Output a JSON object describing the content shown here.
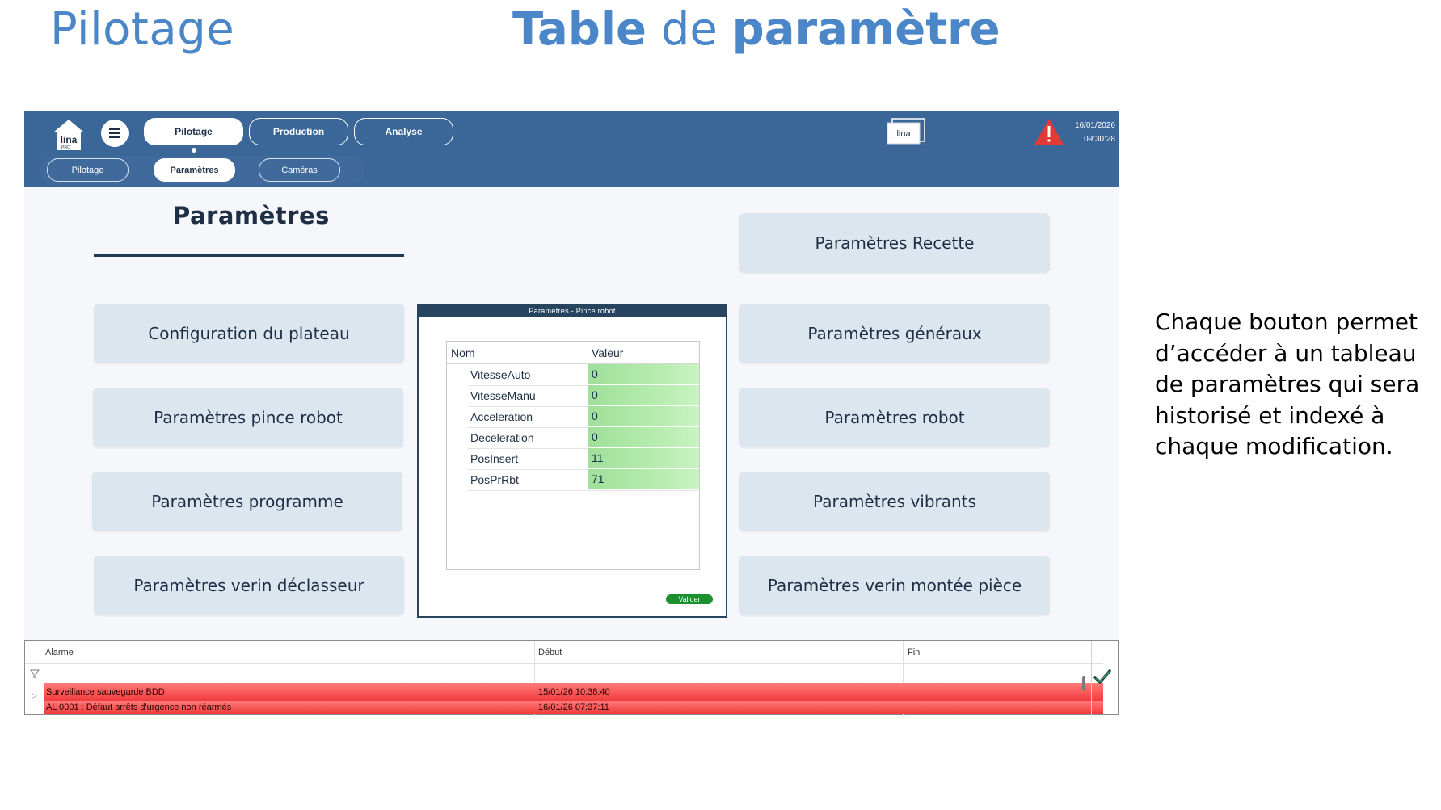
{
  "slide": {
    "title_left": "Pilotage",
    "title_center_1": "Table",
    "title_center_2": "de",
    "title_center_3": "paramètre",
    "caption": "Chaque bouton permet d’accéder à un tableau de paramètres qui sera historisé et indexé à chaque modification."
  },
  "topbar": {
    "logo_text": "lina",
    "logo_sub": "PRO",
    "tabs": [
      "Pilotage",
      "Production",
      "Analyse"
    ],
    "active_tab": "Pilotage",
    "subtabs": [
      "Pilotage",
      "Paramètres",
      "Caméras"
    ],
    "active_subtab": "Paramètres",
    "mini_logo_text": "lina",
    "date": "16/01/2026",
    "time": "09:30:28",
    "colors": {
      "bar": "#3b6698",
      "alert": "#e53935"
    }
  },
  "main": {
    "section_title": "Paramètres",
    "left_buttons": [
      "Configuration du plateau",
      "Paramètres pince robot",
      "Paramètres programme",
      "Paramètres verin déclasseur"
    ],
    "right_buttons": [
      "Paramètres Recette",
      "Paramètres généraux",
      "Paramètres robot",
      "Paramètres vibrants",
      "Paramètres verin montée pièce"
    ]
  },
  "modal": {
    "title": "Paramètres - Pince robot",
    "columns": [
      "Nom",
      "Valeur"
    ],
    "rows": [
      {
        "name": "VitesseAuto",
        "value": "0"
      },
      {
        "name": "VitesseManu",
        "value": "0"
      },
      {
        "name": "Acceleration",
        "value": "0"
      },
      {
        "name": "Deceleration",
        "value": "0"
      },
      {
        "name": "PosInsert",
        "value": "11"
      },
      {
        "name": "PosPrRbt",
        "value": "71"
      }
    ],
    "validate_label": "Valider"
  },
  "alarms": {
    "columns": [
      "Alarme",
      "Début",
      "Fin"
    ],
    "rows": [
      {
        "alarm": "Surveillance sauvegarde BDD",
        "start": "15/01/26 10:38:40",
        "end": ""
      },
      {
        "alarm": "AL 0001 : Défaut arrêts d'urgence non réarmés",
        "start": "16/01/26 07:37:11",
        "end": ""
      }
    ],
    "row_color": "#f23b3b"
  }
}
